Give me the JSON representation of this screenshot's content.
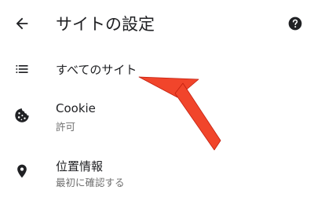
{
  "header": {
    "title": "サイトの設定",
    "back_icon": "arrow-back-icon",
    "help_icon": "help-icon"
  },
  "items": [
    {
      "label": "すべてのサイト",
      "icon": "list-icon"
    },
    {
      "label": "Cookie",
      "sublabel": "許可",
      "icon": "cookie-icon"
    },
    {
      "label": "位置情報",
      "sublabel": "最初に確認する",
      "icon": "location-pin-icon"
    }
  ],
  "annotation": {
    "arrow_color": "#f1452b",
    "points_to": "すべてのサイト"
  }
}
